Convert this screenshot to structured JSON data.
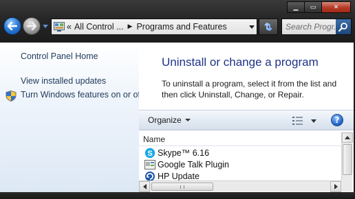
{
  "window": {
    "minimize_glyph": "▁",
    "maximize_glyph": "▭",
    "close_glyph": "✕"
  },
  "address_bar": {
    "path_prefix": "«",
    "segment1": "All Control ...",
    "separator": "▶",
    "segment2": "Programs and Features"
  },
  "search": {
    "placeholder": "Search Progr..."
  },
  "sidebar": {
    "items": [
      {
        "label": "Control Panel Home"
      },
      {
        "label": "View installed updates"
      },
      {
        "label": "Turn Windows features on or off"
      }
    ]
  },
  "main": {
    "title": "Uninstall or change a program",
    "description": "To uninstall a program, select it from the list and then click Uninstall, Change, or Repair."
  },
  "toolbar": {
    "organize_label": "Organize",
    "help_label": "?"
  },
  "list": {
    "column_name": "Name",
    "items": [
      {
        "name": "Skype™ 6.16",
        "icon": "skype-icon"
      },
      {
        "name": "Google Talk Plugin",
        "icon": "google-talk-plugin-icon"
      },
      {
        "name": "HP Update",
        "icon": "hp-update-icon"
      }
    ]
  },
  "colors": {
    "title_blue": "#1e3287",
    "link_blue": "#1e395b",
    "frame_dark": "#1a1a1a",
    "close_red": "#b43a26"
  }
}
